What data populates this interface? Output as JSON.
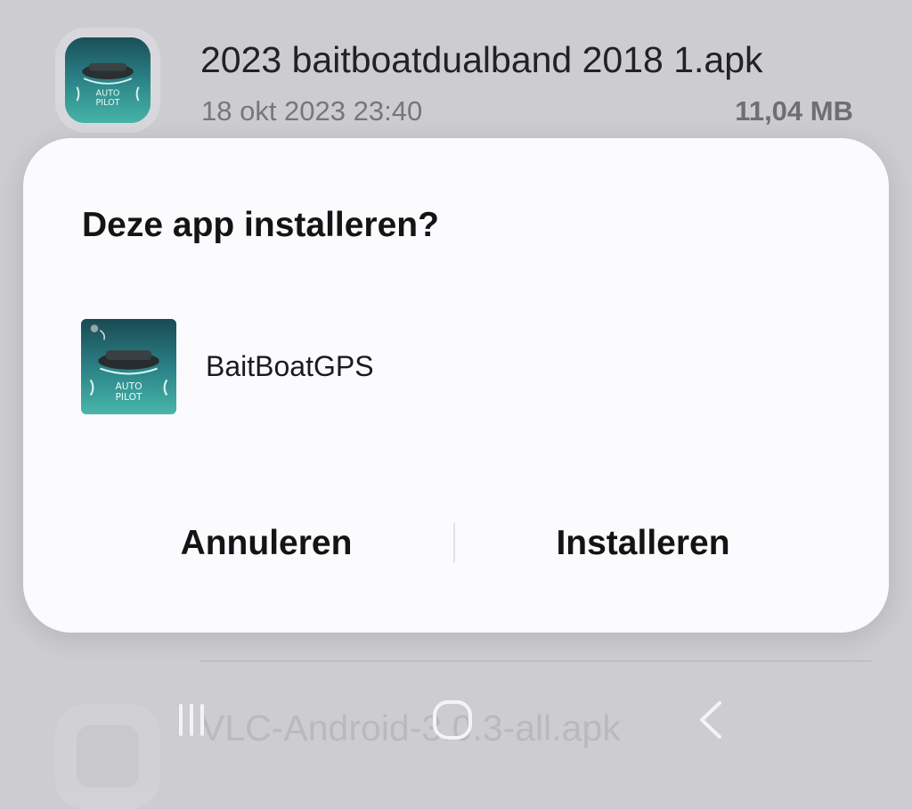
{
  "background_list": {
    "top_file": {
      "name": "2023 baitboatdualband 2018 1.apk",
      "date": "18 okt 2023 23:40",
      "size": "11,04 MB",
      "icon": "baitboat-app-icon"
    },
    "bottom_file": {
      "name": "VLC-Android-3.0.3-all.apk",
      "icon": "vlc-app-icon"
    }
  },
  "dialog": {
    "title": "Deze app installeren?",
    "app_name": "BaitBoatGPS",
    "app_icon": "baitboat-app-icon",
    "app_icon_text_1": "AUTO",
    "app_icon_text_2": "PILOT",
    "cancel_label": "Annuleren",
    "install_label": "Installeren"
  },
  "navbar": {
    "recents_icon": "recents-icon",
    "home_icon": "home-icon",
    "back_icon": "back-icon"
  },
  "colors": {
    "scrim": "#cdcdd1",
    "dialog_bg": "#fbfbfe",
    "text_primary": "#141414",
    "text_secondary": "#77777b",
    "icon_teal": "#2f8c8c"
  }
}
